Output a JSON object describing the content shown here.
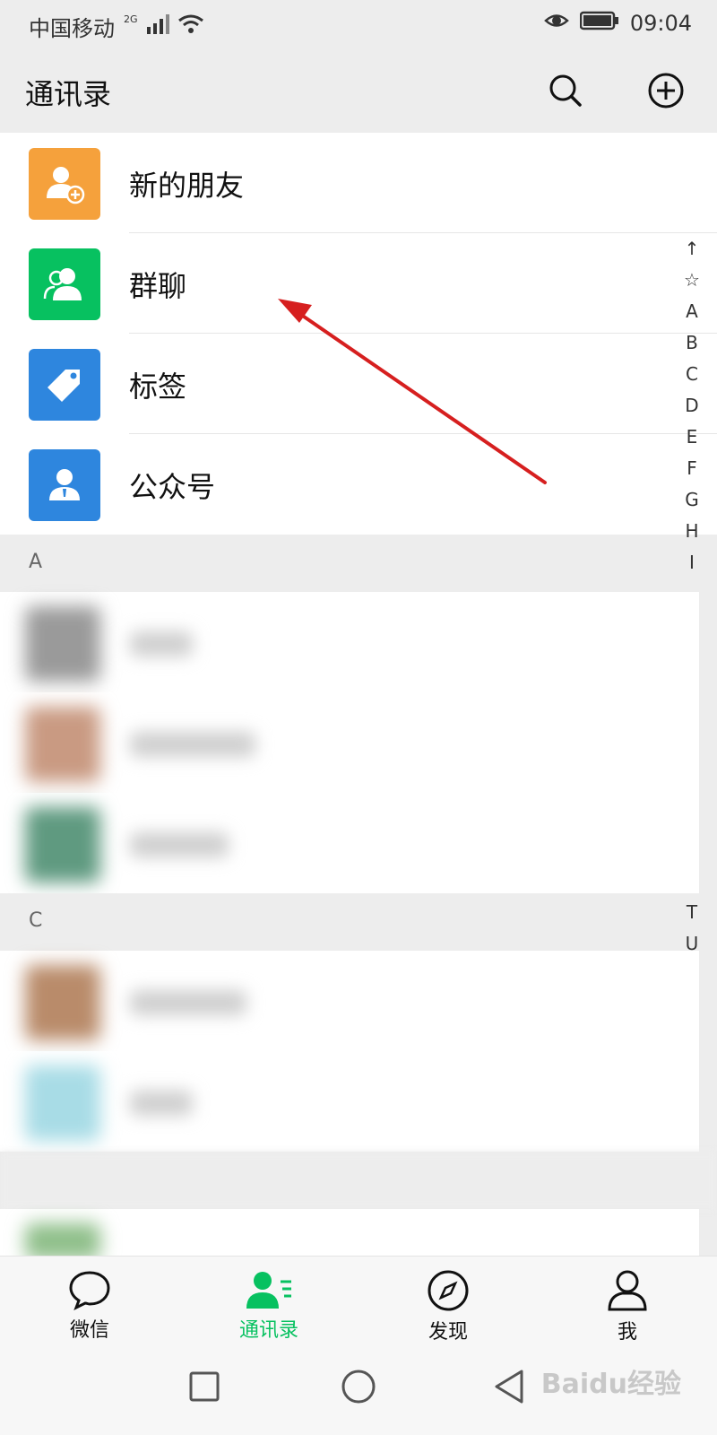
{
  "status": {
    "carrier": "中国移动",
    "network": "2G",
    "time": "09:04"
  },
  "header": {
    "title": "通讯录",
    "search_icon": "search-icon",
    "add_icon": "plus-circle-icon"
  },
  "contacts_menu": [
    {
      "label": "新的朋友",
      "color": "#f5a13c",
      "icon": "add-friend-icon"
    },
    {
      "label": "群聊",
      "color": "#07c160",
      "icon": "group-chat-icon"
    },
    {
      "label": "标签",
      "color": "#2e86de",
      "icon": "tag-icon"
    },
    {
      "label": "公众号",
      "color": "#2e86de",
      "icon": "official-account-icon"
    }
  ],
  "sections": [
    {
      "letter": "A"
    },
    {
      "letter": "C"
    }
  ],
  "index_letters": [
    "↑",
    "☆",
    "A",
    "B",
    "C",
    "D",
    "E",
    "F",
    "G",
    "H",
    "I"
  ],
  "index_letters_bottom": [
    "T",
    "U"
  ],
  "tabs": [
    {
      "label": "微信",
      "icon": "chat-icon"
    },
    {
      "label": "通讯录",
      "icon": "contacts-icon",
      "active": true
    },
    {
      "label": "发现",
      "icon": "discover-icon"
    },
    {
      "label": "我",
      "icon": "me-icon"
    }
  ],
  "watermark": "Baidu经验"
}
